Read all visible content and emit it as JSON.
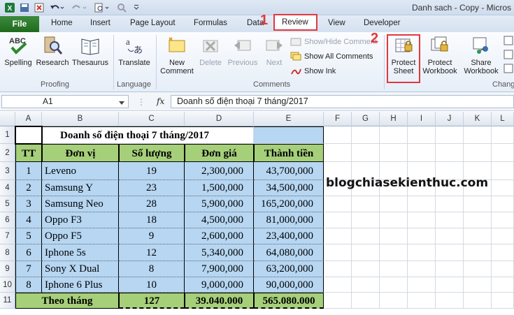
{
  "window_title": "Danh sach - Copy - Micros",
  "tabs": {
    "file": "File",
    "home": "Home",
    "insert": "Insert",
    "page_layout": "Page Layout",
    "formulas": "Formulas",
    "data": "Data",
    "review": "Review",
    "view": "View",
    "developer": "Developer"
  },
  "annotations": {
    "step1": "1",
    "step2": "2"
  },
  "ribbon": {
    "spelling": "Spelling",
    "research": "Research",
    "thesaurus": "Thesaurus",
    "translate": "Translate",
    "new_comment_1": "New",
    "new_comment_2": "Comment",
    "delete": "Delete",
    "previous": "Previous",
    "next": "Next",
    "show_hide_comment": "Show/Hide Comment",
    "show_all_comments": "Show All Comments",
    "show_ink": "Show Ink",
    "protect_sheet_1": "Protect",
    "protect_sheet_2": "Sheet",
    "protect_workbook_1": "Protect",
    "protect_workbook_2": "Workbook",
    "share_workbook_1": "Share",
    "share_workbook_2": "Workbook",
    "group_proofing": "Proofing",
    "group_language": "Language",
    "group_comments": "Comments",
    "group_changes": "Chang"
  },
  "formula_bar": {
    "name_box": "A1",
    "fx": "fx",
    "content": "Doanh số điện thoại 7 tháng/2017"
  },
  "columns": [
    "A",
    "B",
    "C",
    "D",
    "E",
    "F",
    "G",
    "H",
    "I",
    "J",
    "K",
    "L"
  ],
  "rows": [
    "1",
    "2",
    "3",
    "4",
    "5",
    "6",
    "7",
    "8",
    "9",
    "10",
    "11"
  ],
  "sheet": {
    "title": "Doanh số điện thoại 7 tháng/2017",
    "headers": [
      "TT",
      "Đơn vị",
      "Số lượng",
      "Đơn giá",
      "Thành tiền"
    ],
    "data": [
      [
        "1",
        "Leveno",
        "19",
        "2,300,000",
        "43,700,000"
      ],
      [
        "2",
        "Samsung Y",
        "23",
        "1,500,000",
        "34,500,000"
      ],
      [
        "3",
        "Samsung Neo",
        "28",
        "5,900,000",
        "165,200,000"
      ],
      [
        "4",
        "Oppo F3",
        "18",
        "4,500,000",
        "81,000,000"
      ],
      [
        "5",
        "Oppo F5",
        "9",
        "2,600,000",
        "23,400,000"
      ],
      [
        "6",
        "Iphone 5s",
        "12",
        "5,340,000",
        "64,080,000"
      ],
      [
        "7",
        "Sony X Dual",
        "8",
        "7,900,000",
        "63,200,000"
      ],
      [
        "8",
        "Iphone 6 Plus",
        "10",
        "9,000,000",
        "90,000,000"
      ]
    ],
    "total": [
      "Theo tháng",
      "127",
      "39.040.000",
      "565.080.000"
    ]
  },
  "watermark": "blogchiasekienthuc.com",
  "colors": {
    "accent_red": "#e0393e",
    "header_green": "#a6cf7a",
    "cell_blue": "#b6d6f2",
    "file_green": "#2a7a2a"
  }
}
